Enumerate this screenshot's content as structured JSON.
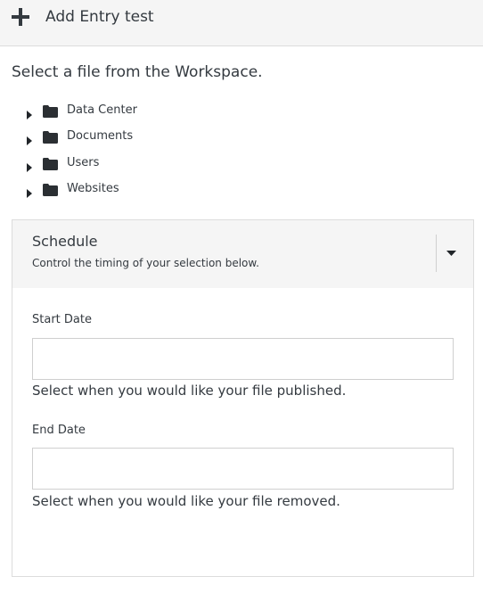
{
  "header": {
    "title": "Add Entry test"
  },
  "intro": "Select a file from the Workspace.",
  "tree": {
    "items": [
      {
        "label": "Data Center"
      },
      {
        "label": "Documents"
      },
      {
        "label": "Users"
      },
      {
        "label": "Websites"
      }
    ]
  },
  "schedule": {
    "title": "Schedule",
    "subtitle": "Control the timing of your selection below.",
    "start": {
      "label": "Start Date",
      "value": "",
      "help": "Select when you would like your file published."
    },
    "end": {
      "label": "End Date",
      "value": "",
      "help": "Select when you would like your file removed."
    }
  },
  "colors": {
    "text": "#343a40",
    "header_bg": "#f5f5f5",
    "border": "#dcdcdc"
  }
}
